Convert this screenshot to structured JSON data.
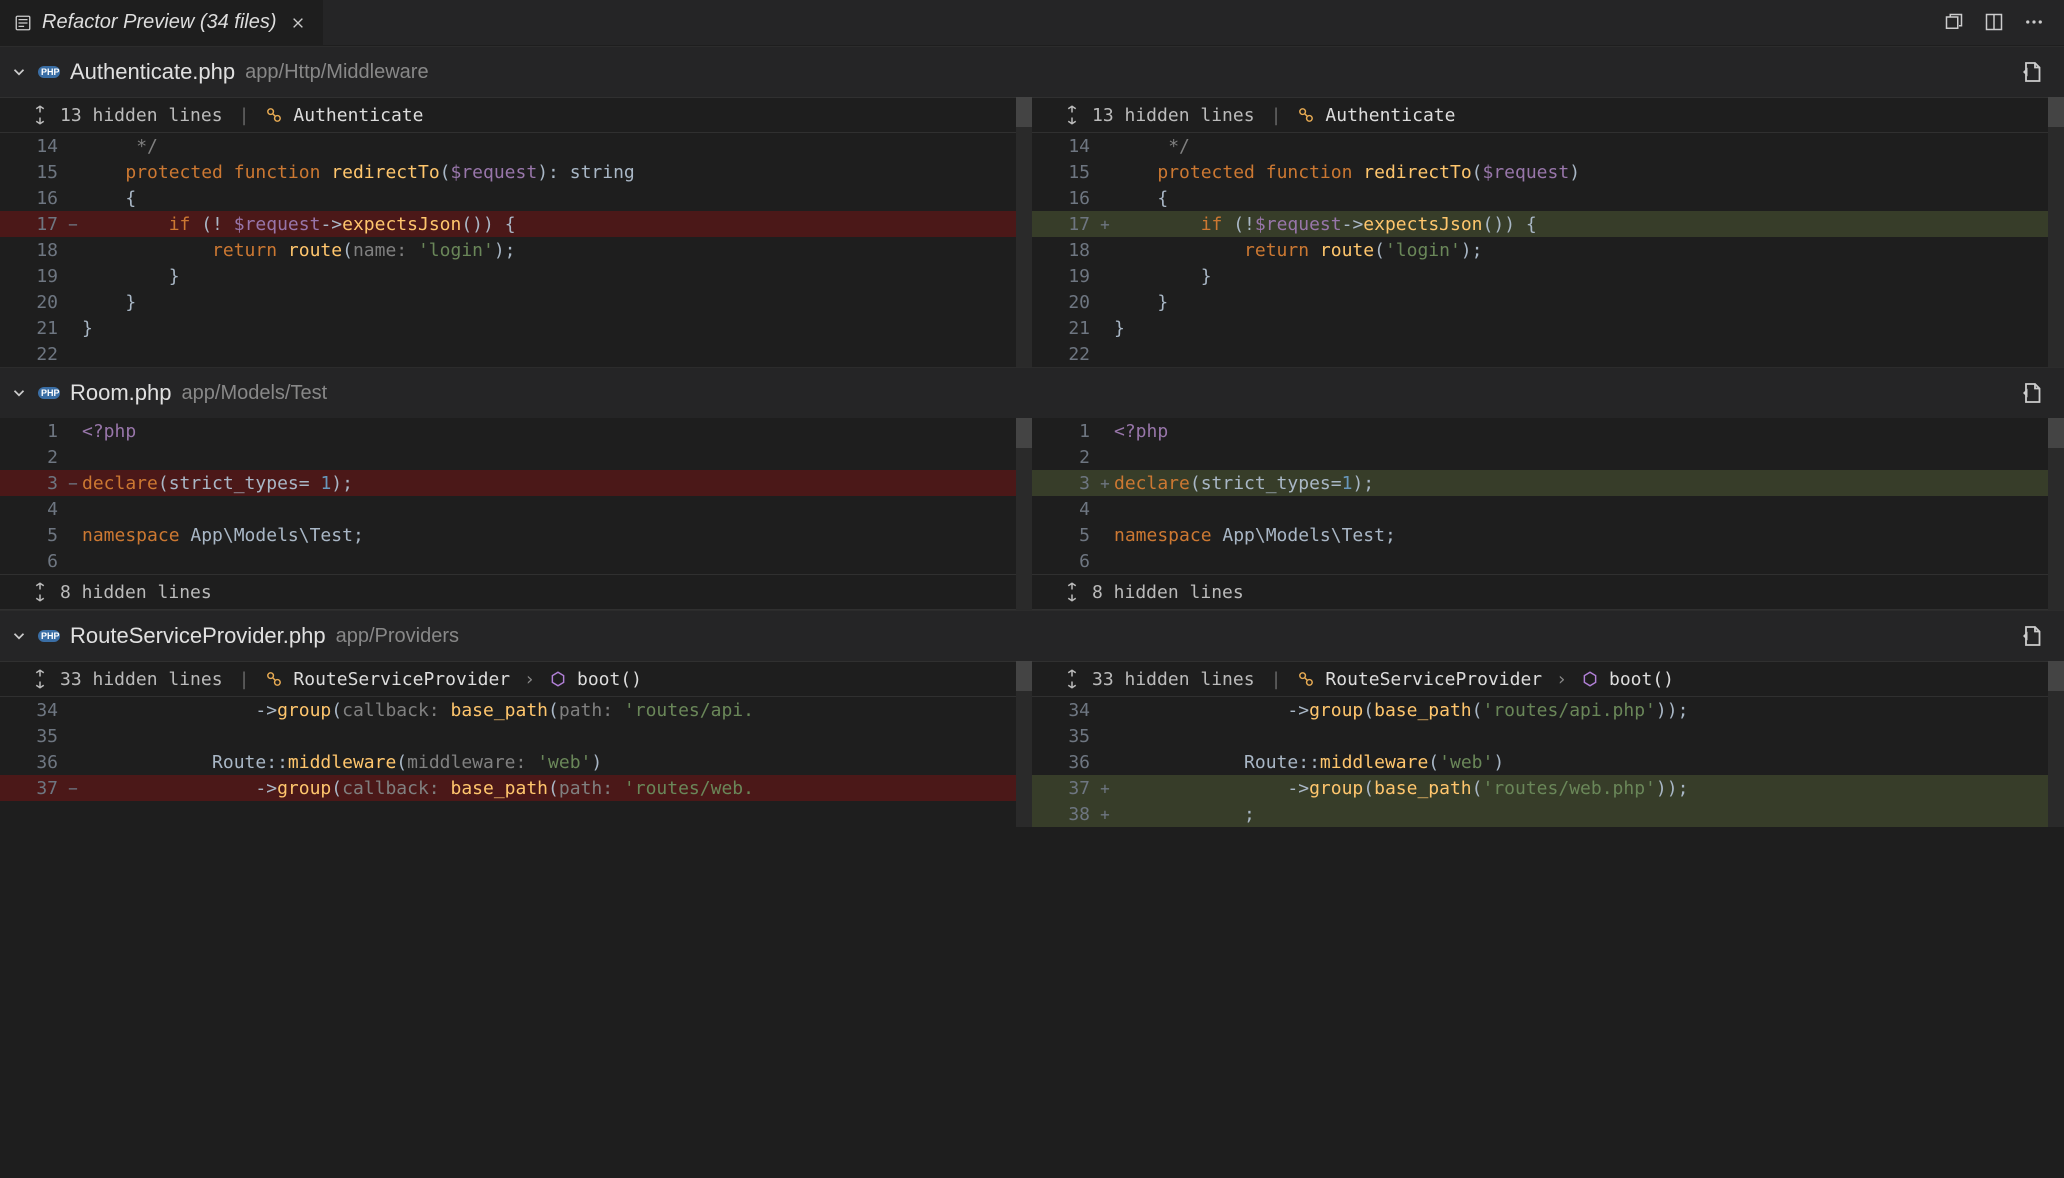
{
  "tab": {
    "title": "Refactor Preview (34 files)"
  },
  "files": [
    {
      "name": "Authenticate.php",
      "path": "app/Http/Middleware",
      "left": {
        "hidden_header": "13 hidden lines",
        "breadcrumb": [
          "Authenticate"
        ],
        "rows": [
          {
            "n": "14",
            "m": "",
            "cls": "",
            "tokens": [
              [
                "    ",
                "plain"
              ],
              [
                " ",
                "plain"
              ],
              [
                "*/",
                "c-comment"
              ]
            ]
          },
          {
            "n": "15",
            "m": "",
            "cls": "",
            "tokens": [
              [
                "    ",
                "plain"
              ],
              [
                "protected ",
                "c-kw"
              ],
              [
                "function ",
                "c-kw"
              ],
              [
                "redirectTo",
                "c-fn"
              ],
              [
                "(",
                "c-punct"
              ],
              [
                "$request",
                "c-var"
              ],
              [
                ")",
                "c-punct"
              ],
              [
                ": ",
                "c-punct"
              ],
              [
                "string",
                "c-type"
              ]
            ]
          },
          {
            "n": "16",
            "m": "",
            "cls": "",
            "tokens": [
              [
                "    ",
                "plain"
              ],
              [
                "{",
                "c-punct"
              ]
            ]
          },
          {
            "n": "17",
            "m": "−",
            "cls": "row-del",
            "tokens": [
              [
                "        ",
                "plain"
              ],
              [
                "if ",
                "c-kw"
              ],
              [
                "(! ",
                "c-punct"
              ],
              [
                "$request",
                "c-var"
              ],
              [
                "->",
                "c-op"
              ],
              [
                "expectsJson",
                "c-fn"
              ],
              [
                "())",
                " c-punct"
              ],
              [
                " {",
                "c-punct"
              ]
            ]
          },
          {
            "n": "18",
            "m": "",
            "cls": "",
            "tokens": [
              [
                "            ",
                "plain"
              ],
              [
                "return ",
                "c-kw"
              ],
              [
                "route",
                "c-fn"
              ],
              [
                "(",
                "c-punct"
              ],
              [
                "name: ",
                "c-named"
              ],
              [
                "'login'",
                "c-str"
              ],
              [
                ");",
                "c-punct"
              ]
            ]
          },
          {
            "n": "19",
            "m": "",
            "cls": "",
            "tokens": [
              [
                "        ",
                "plain"
              ],
              [
                "}",
                "c-punct"
              ]
            ]
          },
          {
            "n": "20",
            "m": "",
            "cls": "",
            "tokens": [
              [
                "    ",
                "plain"
              ],
              [
                "}",
                "c-punct"
              ]
            ]
          },
          {
            "n": "21",
            "m": "",
            "cls": "",
            "tokens": [
              [
                "}",
                "c-punct"
              ]
            ]
          },
          {
            "n": "22",
            "m": "",
            "cls": "",
            "tokens": []
          }
        ]
      },
      "right": {
        "hidden_header": "13 hidden lines",
        "breadcrumb": [
          "Authenticate"
        ],
        "rows": [
          {
            "n": "14",
            "m": "",
            "cls": "",
            "tokens": [
              [
                "    ",
                "plain"
              ],
              [
                " ",
                "plain"
              ],
              [
                "*/",
                "c-comment"
              ]
            ]
          },
          {
            "n": "15",
            "m": "",
            "cls": "",
            "tokens": [
              [
                "    ",
                "plain"
              ],
              [
                "protected ",
                "c-kw"
              ],
              [
                "function ",
                "c-kw"
              ],
              [
                "redirectTo",
                "c-fn"
              ],
              [
                "(",
                "c-punct"
              ],
              [
                "$request",
                "c-var"
              ],
              [
                ")",
                "c-punct"
              ]
            ]
          },
          {
            "n": "16",
            "m": "",
            "cls": "",
            "tokens": [
              [
                "    ",
                "plain"
              ],
              [
                "{",
                "c-punct"
              ]
            ]
          },
          {
            "n": "17",
            "m": "+",
            "cls": "row-add",
            "tokens": [
              [
                "        ",
                "plain"
              ],
              [
                "if ",
                "c-kw"
              ],
              [
                "(!",
                "c-punct"
              ],
              [
                "$request",
                "c-var"
              ],
              [
                "->",
                "c-op"
              ],
              [
                "expectsJson",
                "c-fn"
              ],
              [
                "())",
                " c-punct"
              ],
              [
                " {",
                "c-punct"
              ]
            ]
          },
          {
            "n": "18",
            "m": "",
            "cls": "",
            "tokens": [
              [
                "            ",
                "plain"
              ],
              [
                "return ",
                "c-kw"
              ],
              [
                "route",
                "c-fn"
              ],
              [
                "(",
                "c-punct"
              ],
              [
                "'login'",
                "c-str"
              ],
              [
                ");",
                "c-punct"
              ]
            ]
          },
          {
            "n": "19",
            "m": "",
            "cls": "",
            "tokens": [
              [
                "        ",
                "plain"
              ],
              [
                "}",
                "c-punct"
              ]
            ]
          },
          {
            "n": "20",
            "m": "",
            "cls": "",
            "tokens": [
              [
                "    ",
                "plain"
              ],
              [
                "}",
                "c-punct"
              ]
            ]
          },
          {
            "n": "21",
            "m": "",
            "cls": "",
            "tokens": [
              [
                "}",
                "c-punct"
              ]
            ]
          },
          {
            "n": "22",
            "m": "",
            "cls": "",
            "tokens": []
          }
        ]
      }
    },
    {
      "name": "Room.php",
      "path": "app/Models/Test",
      "left": {
        "rows": [
          {
            "n": "1",
            "m": "",
            "cls": "",
            "tokens": [
              [
                "<?php",
                "c-tag"
              ]
            ]
          },
          {
            "n": "2",
            "m": "",
            "cls": "",
            "tokens": []
          },
          {
            "n": "3",
            "m": "−",
            "cls": "row-del",
            "tokens": [
              [
                "declare",
                "c-kw"
              ],
              [
                "(",
                "c-punct"
              ],
              [
                "strict_types",
                "c-type"
              ],
              [
                "= ",
                "c-punct"
              ],
              [
                "1",
                "c-blue"
              ],
              [
                ");",
                "c-punct"
              ]
            ]
          },
          {
            "n": "4",
            "m": "",
            "cls": "",
            "tokens": []
          },
          {
            "n": "5",
            "m": "",
            "cls": "",
            "tokens": [
              [
                "namespace ",
                "c-kw"
              ],
              [
                "App\\Models\\Test",
                "c-class"
              ],
              [
                ";",
                "c-punct"
              ]
            ]
          },
          {
            "n": "6",
            "m": "",
            "cls": "",
            "tokens": []
          }
        ],
        "hidden_footer": "8 hidden lines"
      },
      "right": {
        "rows": [
          {
            "n": "1",
            "m": "",
            "cls": "",
            "tokens": [
              [
                "<?php",
                "c-tag"
              ]
            ]
          },
          {
            "n": "2",
            "m": "",
            "cls": "",
            "tokens": []
          },
          {
            "n": "3",
            "m": "+",
            "cls": "row-add",
            "tokens": [
              [
                "declare",
                "c-kw"
              ],
              [
                "(",
                "c-punct"
              ],
              [
                "strict_types",
                "c-type"
              ],
              [
                "=",
                "c-punct"
              ],
              [
                "1",
                "c-blue"
              ],
              [
                ");",
                "c-punct"
              ]
            ]
          },
          {
            "n": "4",
            "m": "",
            "cls": "",
            "tokens": []
          },
          {
            "n": "5",
            "m": "",
            "cls": "",
            "tokens": [
              [
                "namespace ",
                "c-kw"
              ],
              [
                "App\\Models\\Test",
                "c-class"
              ],
              [
                ";",
                "c-punct"
              ]
            ]
          },
          {
            "n": "6",
            "m": "",
            "cls": "",
            "tokens": []
          }
        ],
        "hidden_footer": "8 hidden lines"
      }
    },
    {
      "name": "RouteServiceProvider.php",
      "path": "app/Providers",
      "left": {
        "hidden_header": "33 hidden lines",
        "breadcrumb": [
          "RouteServiceProvider",
          "boot()"
        ],
        "rows": [
          {
            "n": "34",
            "m": "",
            "cls": "",
            "tokens": [
              [
                "                ",
                "plain"
              ],
              [
                "->",
                "c-op"
              ],
              [
                "group",
                "c-fn"
              ],
              [
                "(",
                "c-punct"
              ],
              [
                "callback: ",
                "c-named"
              ],
              [
                "base_path",
                "c-fn"
              ],
              [
                "(",
                "c-punct"
              ],
              [
                "path: ",
                "c-named"
              ],
              [
                "'routes/api.",
                "c-str"
              ]
            ]
          },
          {
            "n": "35",
            "m": "",
            "cls": "",
            "tokens": []
          },
          {
            "n": "36",
            "m": "",
            "cls": "",
            "tokens": [
              [
                "            ",
                "plain"
              ],
              [
                "Route",
                "c-class"
              ],
              [
                "::",
                "c-op"
              ],
              [
                "middleware",
                "c-fn"
              ],
              [
                "(",
                "c-punct"
              ],
              [
                "middleware: ",
                "c-named"
              ],
              [
                "'web'",
                "c-str"
              ],
              [
                ")",
                "c-punct"
              ]
            ]
          },
          {
            "n": "37",
            "m": "−",
            "cls": "row-del",
            "tokens": [
              [
                "                ",
                "plain"
              ],
              [
                "->",
                "c-op"
              ],
              [
                "group",
                "c-fn"
              ],
              [
                "(",
                "c-punct"
              ],
              [
                "callback: ",
                "c-named"
              ],
              [
                "base_path",
                "c-fn"
              ],
              [
                "(",
                "c-punct"
              ],
              [
                "path: ",
                "c-named"
              ],
              [
                "'routes/web.",
                "c-str"
              ]
            ]
          }
        ]
      },
      "right": {
        "hidden_header": "33 hidden lines",
        "breadcrumb": [
          "RouteServiceProvider",
          "boot()"
        ],
        "rows": [
          {
            "n": "34",
            "m": "",
            "cls": "",
            "tokens": [
              [
                "                ",
                "plain"
              ],
              [
                "->",
                "c-op"
              ],
              [
                "group",
                "c-fn"
              ],
              [
                "(",
                "c-punct"
              ],
              [
                "base_path",
                "c-fn"
              ],
              [
                "(",
                "c-punct"
              ],
              [
                "'routes/api.php'",
                "c-str"
              ],
              [
                "));",
                "c-punct"
              ]
            ]
          },
          {
            "n": "35",
            "m": "",
            "cls": "",
            "tokens": []
          },
          {
            "n": "36",
            "m": "",
            "cls": "",
            "tokens": [
              [
                "            ",
                "plain"
              ],
              [
                "Route",
                "c-class"
              ],
              [
                "::",
                "c-op"
              ],
              [
                "middleware",
                "c-fn"
              ],
              [
                "(",
                "c-punct"
              ],
              [
                "'web'",
                "c-str"
              ],
              [
                ")",
                "c-punct"
              ]
            ]
          },
          {
            "n": "37",
            "m": "+",
            "cls": "row-add",
            "tokens": [
              [
                "                ",
                "plain"
              ],
              [
                "->",
                "c-op"
              ],
              [
                "group",
                "c-fn"
              ],
              [
                "(",
                "c-punct"
              ],
              [
                "base_path",
                "c-fn"
              ],
              [
                "(",
                "c-punct"
              ],
              [
                "'routes/web.php'",
                "c-str"
              ],
              [
                "));",
                "c-punct"
              ]
            ]
          },
          {
            "n": "38",
            "m": "+",
            "cls": "row-add",
            "tokens": [
              [
                "            ",
                "plain"
              ],
              [
                ";",
                "c-punct"
              ]
            ]
          }
        ]
      }
    }
  ]
}
